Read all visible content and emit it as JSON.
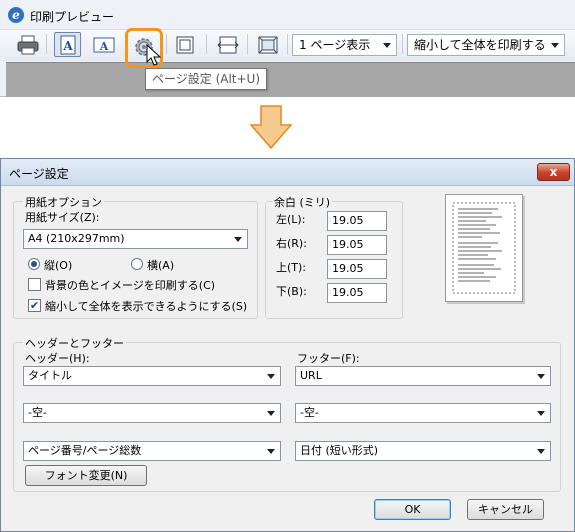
{
  "preview": {
    "title": "印刷プレビュー",
    "app_icon_glyph": "e",
    "page_view_select": "1 ページ表示",
    "fit_select": "縮小して全体を印刷する",
    "tooltip": "ページ設定 (Alt+U)"
  },
  "dialog": {
    "title": "ページ設定",
    "close_label": "x",
    "paper": {
      "group_label": "用紙オプション",
      "size_label": "用紙サイズ(Z):",
      "size_value": "A4 (210x297mm)",
      "portrait_label": "縦(O)",
      "landscape_label": "横(A)",
      "orientation_selected": "portrait",
      "bg_print_label": "背景の色とイメージを印刷する(C)",
      "bg_print_checked": false,
      "shrink_label": "縮小して全体を表示できるようにする(S)",
      "shrink_checked": true
    },
    "margins": {
      "group_label": "余白 (ミリ)",
      "left_label": "左(L):",
      "left_value": "19.05",
      "right_label": "右(R):",
      "right_value": "19.05",
      "top_label": "上(T):",
      "top_value": "19.05",
      "bottom_label": "下(B):",
      "bottom_value": "19.05"
    },
    "header_footer": {
      "group_label": "ヘッダーとフッター",
      "header_label": "ヘッダー(H):",
      "footer_label": "フッター(F):",
      "header_values": [
        "タイトル",
        "-空-",
        "ページ番号/ページ総数"
      ],
      "footer_values": [
        "URL",
        "-空-",
        "日付 (短い形式)"
      ],
      "font_button": "フォント変更(N)"
    },
    "ok_label": "OK",
    "cancel_label": "キャンセル"
  },
  "colors": {
    "highlight": "#f3961c",
    "arrow_fill": "#f6c98e",
    "arrow_stroke": "#e08a1e"
  }
}
